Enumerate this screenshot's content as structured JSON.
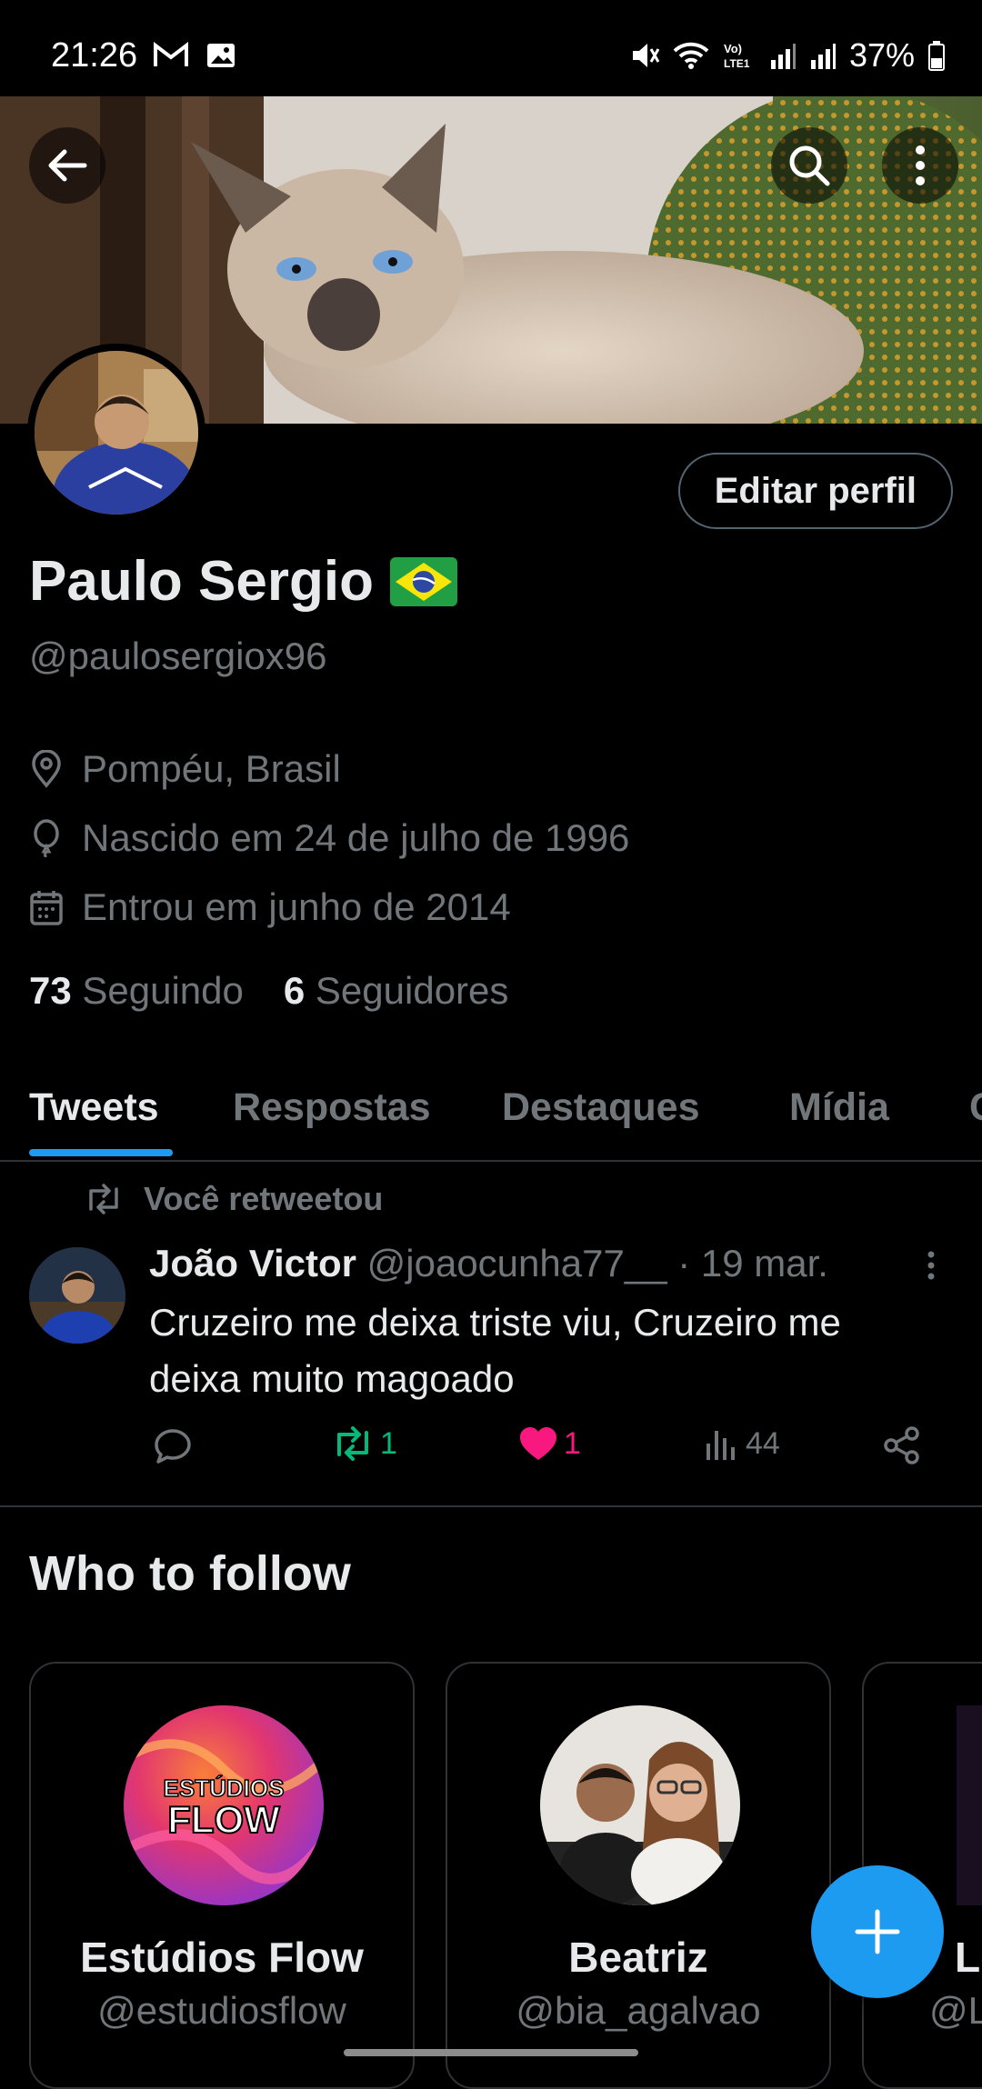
{
  "status_bar": {
    "time": "21:26",
    "battery": "37%"
  },
  "profile": {
    "name": "Paulo Sergio",
    "flag": "🇧🇷",
    "handle": "@paulosergiox96",
    "edit_label": "Editar perfil",
    "location": "Pompéu, Brasil",
    "birth": "Nascido em 24 de julho de 1996",
    "joined": "Entrou em junho de 2014",
    "following_count": "73",
    "following_label": "Seguindo",
    "followers_count": "6",
    "followers_label": "Seguidores"
  },
  "tabs": [
    {
      "label": "Tweets"
    },
    {
      "label": "Respostas"
    },
    {
      "label": "Destaques"
    },
    {
      "label": "Mídia"
    },
    {
      "label": "C"
    }
  ],
  "tweet": {
    "retweet_note": "Você retweetou",
    "author": "João Victor",
    "handle": "@joaocunha77__",
    "separator": "·",
    "date": "19 mar.",
    "text": "Cruzeiro me deixa triste viu, Cruzeiro me deixa muito magoado",
    "retweets": "1",
    "likes": "1",
    "views": "44"
  },
  "who_to_follow": {
    "title": "Who to follow",
    "cards": [
      {
        "name": "Estúdios Flow",
        "handle": "@estudiosflow",
        "avatar_text": "ESTÚDIOS\nFLOW"
      },
      {
        "name": "Beatriz",
        "handle": "@bia_agalvao"
      },
      {
        "name": "Le",
        "handle": "@L"
      }
    ]
  },
  "colors": {
    "accent": "#1d9bf0",
    "retweet": "#00ba7c",
    "like": "#f91880",
    "secondary_text": "#71767b"
  }
}
